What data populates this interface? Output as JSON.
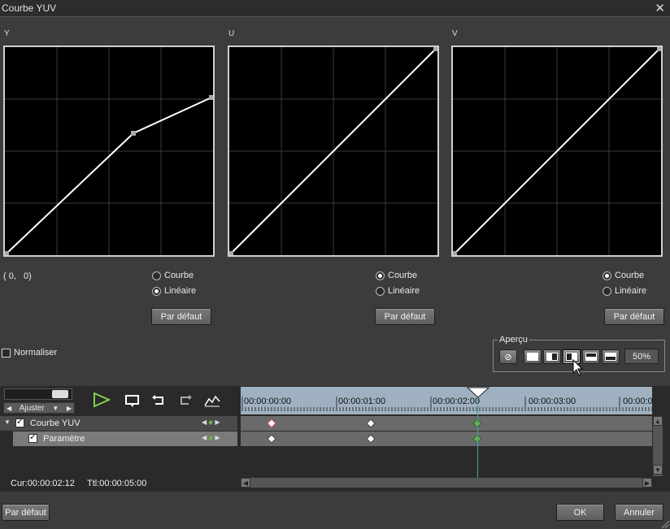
{
  "window": {
    "title": "Courbe YUV",
    "close_icon": "close-icon"
  },
  "channels": [
    {
      "label": "Y",
      "mode_curve": "Courbe",
      "mode_linear": "Linéaire",
      "selected": "linear",
      "default_label": "Par défaut"
    },
    {
      "label": "U",
      "mode_curve": "Courbe",
      "mode_linear": "Linéaire",
      "selected": "curve",
      "default_label": "Par défaut"
    },
    {
      "label": "V",
      "mode_curve": "Courbe",
      "mode_linear": "Linéaire",
      "selected": "curve",
      "default_label": "Par défaut"
    }
  ],
  "coord_readout": "( 0,   0)",
  "normaliser": {
    "label": "Normaliser",
    "checked": false
  },
  "apercu": {
    "label": "Aperçu",
    "zoom": "50%"
  },
  "timeline": {
    "fit_label": "Ajuster",
    "ruler_labels": [
      "00:00:00:00",
      "00:00:01:00",
      "00:00:02:00",
      "00:00:03:00",
      "00:00:0"
    ],
    "tracks": [
      {
        "label": "Courbe YUV",
        "checked": true
      },
      {
        "label": "Paramètre",
        "checked": true
      }
    ],
    "cur": "Cur:00:00:02:12",
    "ttl": "Ttl:00:00:05:00"
  },
  "footer": {
    "default_label": "Par défaut",
    "ok_label": "OK",
    "cancel_label": "Annuler"
  },
  "colors": {
    "background": "#3c3c3c",
    "keyframe_green": "#68b04a",
    "ruler": "#9fb1c0",
    "playhead": "#3fa3a8"
  }
}
